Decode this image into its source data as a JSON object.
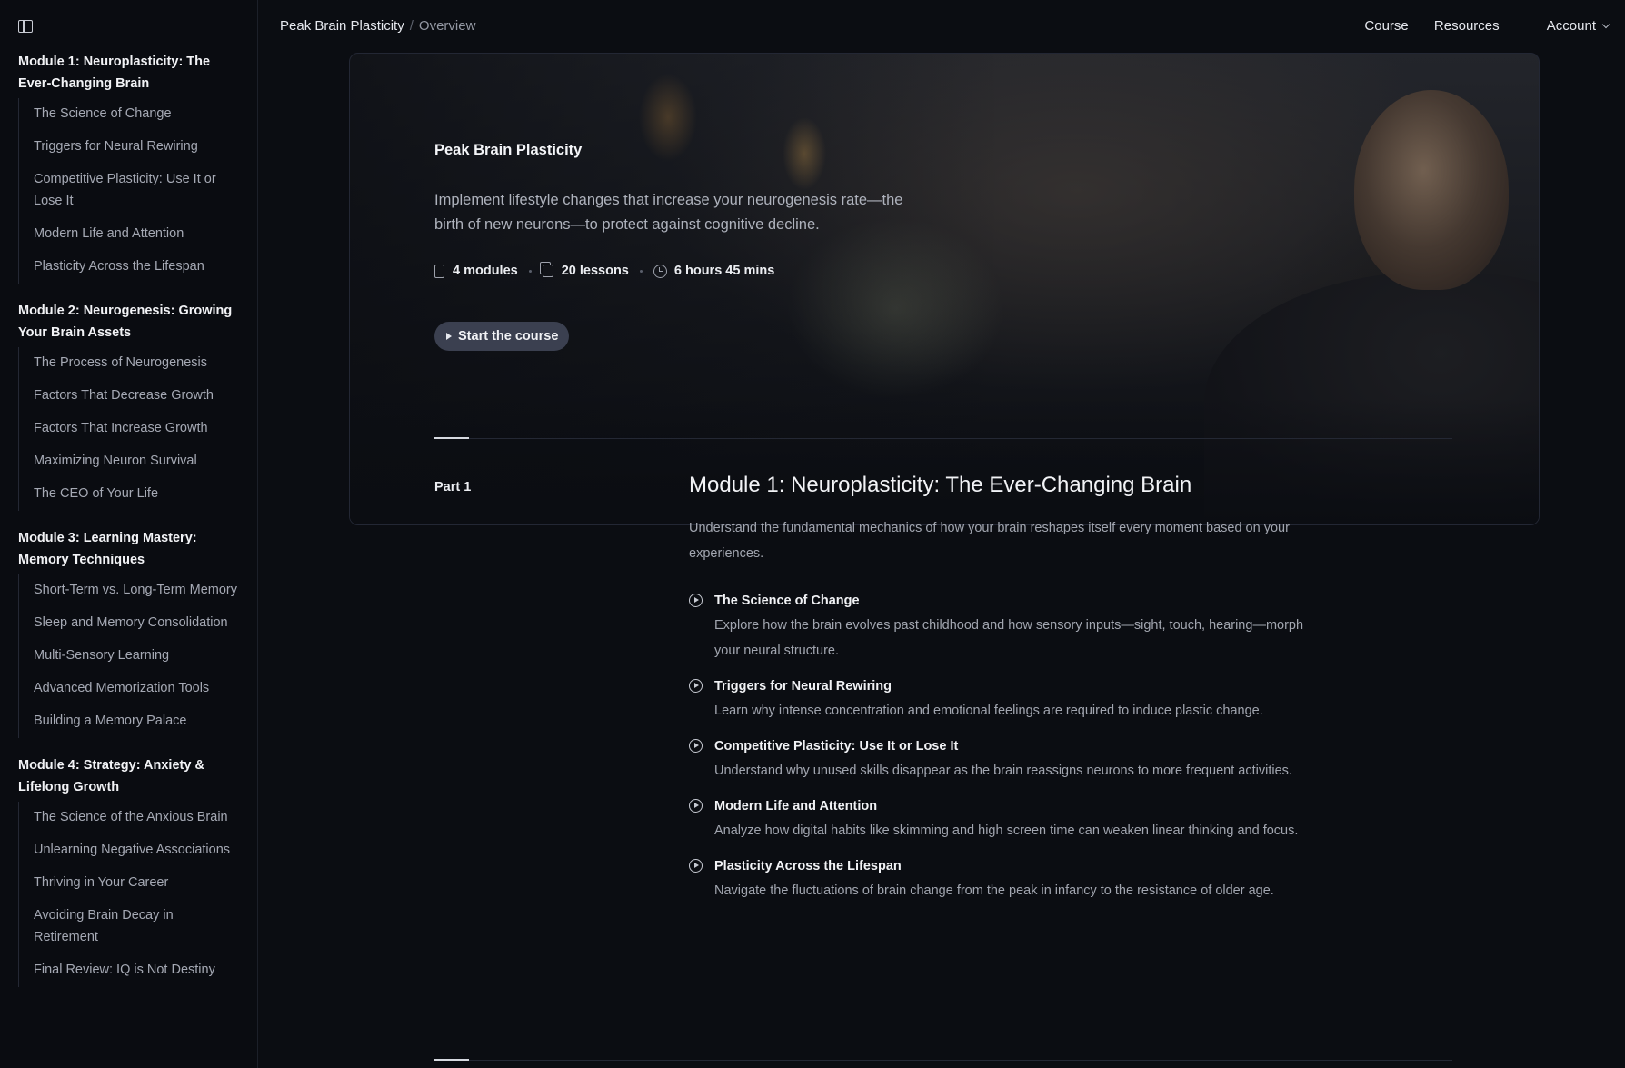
{
  "breadcrumb": {
    "course": "Peak Brain Plasticity",
    "separator": "/",
    "current": "Overview"
  },
  "topnav": {
    "course": "Course",
    "resources": "Resources",
    "account": "Account"
  },
  "sidebar": {
    "modules": [
      {
        "title": "Module 1: Neuroplasticity: The Ever-Changing Brain",
        "lessons": [
          "The Science of Change",
          "Triggers for Neural Rewiring",
          "Competitive Plasticity: Use It or Lose It",
          "Modern Life and Attention",
          "Plasticity Across the Lifespan"
        ]
      },
      {
        "title": "Module 2: Neurogenesis: Growing Your Brain Assets",
        "lessons": [
          "The Process of Neurogenesis",
          "Factors That Decrease Growth",
          "Factors That Increase Growth",
          "Maximizing Neuron Survival",
          "The CEO of Your Life"
        ]
      },
      {
        "title": "Module 3: Learning Mastery: Memory Techniques",
        "lessons": [
          "Short-Term vs. Long-Term Memory",
          "Sleep and Memory Consolidation",
          "Multi-Sensory Learning",
          "Advanced Memorization Tools",
          "Building a Memory Palace"
        ]
      },
      {
        "title": "Module 4: Strategy: Anxiety & Lifelong Growth",
        "lessons": [
          "The Science of the Anxious Brain",
          "Unlearning Negative Associations",
          "Thriving in Your Career",
          "Avoiding Brain Decay in Retirement",
          "Final Review: IQ is Not Destiny"
        ]
      }
    ]
  },
  "hero": {
    "title": "Peak Brain Plasticity",
    "description": "Implement lifestyle changes that increase your neurogenesis rate—the birth of new neurons—to protect against cognitive decline.",
    "stats": {
      "modules": "4 modules",
      "lessons": "20 lessons",
      "duration": "6 hours 45 mins"
    },
    "cta": "Start the course"
  },
  "main": {
    "part_label": "Part 1",
    "module_title": "Module 1: Neuroplasticity: The Ever-Changing Brain",
    "module_desc": "Understand the fundamental mechanics of how your brain reshapes itself every moment based on your experiences.",
    "lessons": [
      {
        "title": "The Science of Change",
        "desc": "Explore how the brain evolves past childhood and how sensory inputs—sight, touch, hearing—morph your neural structure."
      },
      {
        "title": "Triggers for Neural Rewiring",
        "desc": "Learn why intense concentration and emotional feelings are required to induce plastic change."
      },
      {
        "title": "Competitive Plasticity: Use It or Lose It",
        "desc": "Understand why unused skills disappear as the brain reassigns neurons to more frequent activities."
      },
      {
        "title": "Modern Life and Attention",
        "desc": "Analyze how digital habits like skimming and high screen time can weaken linear thinking and focus."
      },
      {
        "title": "Plasticity Across the Lifespan",
        "desc": "Navigate the fluctuations of brain change from the peak in infancy to the resistance of older age."
      }
    ]
  }
}
